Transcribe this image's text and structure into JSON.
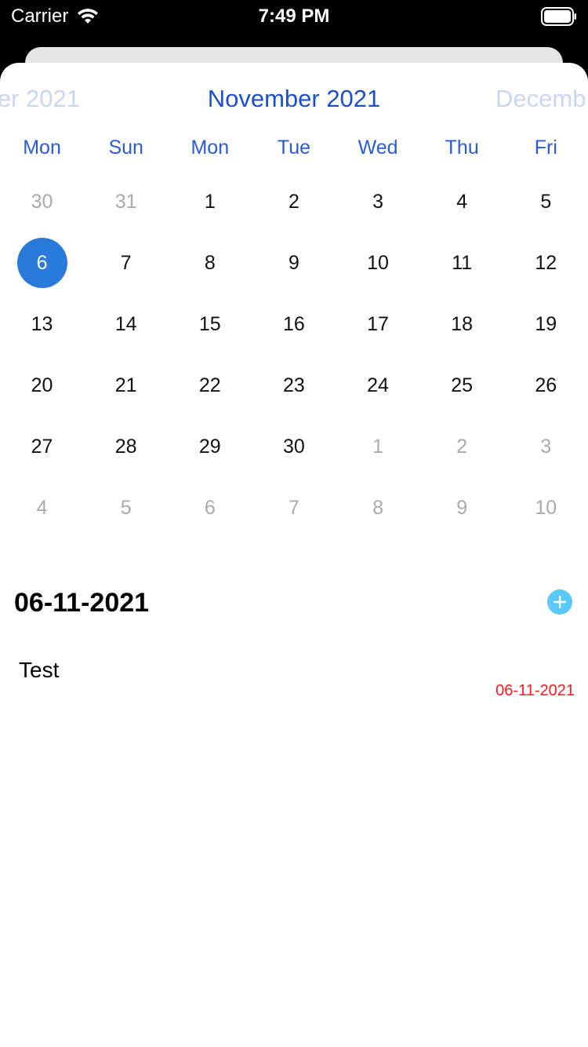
{
  "status_bar": {
    "carrier": "Carrier",
    "time": "7:49 PM",
    "icons": [
      "wifi-icon",
      "battery-icon"
    ]
  },
  "calendar": {
    "prev_month": "er 2021",
    "current_month": "November 2021",
    "next_month": "Decemb",
    "weekdays": [
      "Mon",
      "Sun",
      "Mon",
      "Tue",
      "Wed",
      "Thu",
      "Fri"
    ],
    "weeks": [
      [
        {
          "d": "30",
          "muted": true
        },
        {
          "d": "31",
          "muted": true
        },
        {
          "d": "1"
        },
        {
          "d": "2"
        },
        {
          "d": "3"
        },
        {
          "d": "4"
        },
        {
          "d": "5"
        }
      ],
      [
        {
          "d": "6",
          "selected": true
        },
        {
          "d": "7"
        },
        {
          "d": "8"
        },
        {
          "d": "9"
        },
        {
          "d": "10"
        },
        {
          "d": "11"
        },
        {
          "d": "12"
        }
      ],
      [
        {
          "d": "13"
        },
        {
          "d": "14"
        },
        {
          "d": "15"
        },
        {
          "d": "16"
        },
        {
          "d": "17"
        },
        {
          "d": "18"
        },
        {
          "d": "19"
        }
      ],
      [
        {
          "d": "20"
        },
        {
          "d": "21"
        },
        {
          "d": "22"
        },
        {
          "d": "23"
        },
        {
          "d": "24"
        },
        {
          "d": "25"
        },
        {
          "d": "26"
        }
      ],
      [
        {
          "d": "27"
        },
        {
          "d": "28"
        },
        {
          "d": "29"
        },
        {
          "d": "30"
        },
        {
          "d": "1",
          "muted": true
        },
        {
          "d": "2",
          "muted": true
        },
        {
          "d": "3",
          "muted": true
        }
      ],
      [
        {
          "d": "4",
          "muted": true
        },
        {
          "d": "5",
          "muted": true
        },
        {
          "d": "6",
          "muted": true
        },
        {
          "d": "7",
          "muted": true
        },
        {
          "d": "8",
          "muted": true
        },
        {
          "d": "9",
          "muted": true
        },
        {
          "d": "10",
          "muted": true
        }
      ]
    ],
    "colors": {
      "accent": "#1a4fd0",
      "selected": "#2a7ad9",
      "muted": "#aaaaaa",
      "faded_month": "#c9d6f3"
    }
  },
  "selected_day": {
    "date": "06-11-2021",
    "add_icon": "plus-circle-icon",
    "add_color": "#5ac8fa"
  },
  "events": [
    {
      "title": "Test",
      "date": "06-11-2021",
      "date_color": "#ff1a1a"
    }
  ]
}
